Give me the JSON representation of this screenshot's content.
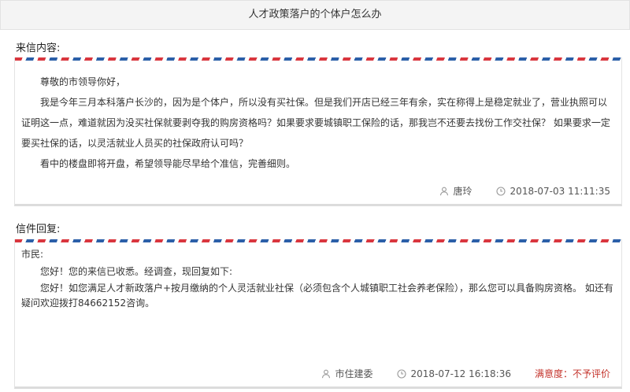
{
  "page": {
    "title": "人才政策落户的个体户怎么办"
  },
  "letter": {
    "section_label": "来信内容:",
    "paragraphs": [
      "尊敬的市领导你好，",
      "我是今年三月本科落户长沙的，因为是个体户，所以没有买社保。但是我们开店已经三年有余，实在称得上是稳定就业了，营业执照可以证明这一点，难道就因为没买社保就要剥夺我的购房资格吗？如果要求要城镇职工保险的话，那我岂不还要去找份工作交社保？ 如果要求一定要买社保的话，以灵活就业人员买的社保政府认可吗？",
      "看中的楼盘即将开盘，希望领导能尽早给个准信，完善细则。"
    ],
    "author": "唐玲",
    "timestamp": "2018-07-03 11:11:35"
  },
  "reply": {
    "section_label": "信件回复:",
    "greeting": "市民:",
    "line1": "您好！您的来信已收悉。经调查，现回复如下:",
    "line2": "您好！如您满足人才新政落户+按月缴纳的个人灵活就业社保（必须包含个人城镇职工社会养老保险），那么您可以具备购房资格。 如还有疑问欢迎拨打84662152咨询。",
    "responder": "市住建委",
    "timestamp": "2018-07-12 16:18:36",
    "satisfaction": "满意度：不予评价"
  },
  "colors": {
    "airmail_red": "#d9363e",
    "airmail_blue": "#2b5fa8",
    "satisfaction_text": "#c4332b"
  },
  "icons": {
    "author": "user-icon",
    "time": "clock-icon"
  }
}
